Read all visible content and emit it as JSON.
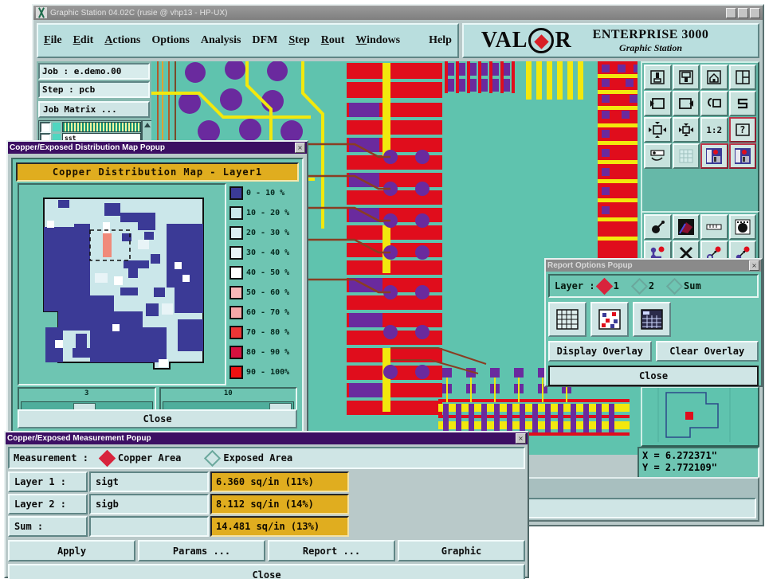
{
  "window": {
    "title": "Graphic Station 04.02C (rusie @ vhp13 - HP-UX)"
  },
  "menubar": {
    "items": [
      {
        "label": "File",
        "accel": "F"
      },
      {
        "label": "Edit",
        "accel": "E"
      },
      {
        "label": "Actions",
        "accel": "A"
      },
      {
        "label": "Options",
        "accel": "O"
      },
      {
        "label": "Analysis",
        "accel": ""
      },
      {
        "label": "DFM",
        "accel": ""
      },
      {
        "label": "Step",
        "accel": "S"
      },
      {
        "label": "Rout",
        "accel": "R"
      },
      {
        "label": "Windows",
        "accel": "W"
      },
      {
        "label": "Help",
        "accel": ""
      }
    ]
  },
  "branding": {
    "logo": "VALOR",
    "product": "ENTERPRISE 3000",
    "subtitle": "Graphic Station"
  },
  "job_panel": {
    "job_label": "Job   :  e.demo.00",
    "step_label": "Step :  pcb",
    "matrix_button": "Job Matrix ...",
    "layers": [
      {
        "name": "",
        "pattern": "dashed"
      },
      {
        "name": "sst",
        "pattern": "solid"
      }
    ]
  },
  "coords": {
    "x": "X = 6.272371\"",
    "y": "Y = 2.772109\""
  },
  "distribution_map": {
    "title": "Copper/Exposed Distribution Map Popup",
    "header": "Copper Distribution Map - Layer1",
    "close_label": "Close",
    "scale_left": "3",
    "scale_right": "10",
    "legend": [
      {
        "label": "0  - 10 %",
        "color": "#3b3a96"
      },
      {
        "label": "10 - 20 %",
        "color": "#cbe7ea"
      },
      {
        "label": "20 - 30 %",
        "color": "#dceff2"
      },
      {
        "label": "30 - 40 %",
        "color": "#e8f4f7"
      },
      {
        "label": "40 - 50 %",
        "color": "#ffffff"
      },
      {
        "label": "50 - 60 %",
        "color": "#f7b8b8"
      },
      {
        "label": "60 - 70 %",
        "color": "#f6a7a7"
      },
      {
        "label": "70 - 80 %",
        "color": "#ec3636"
      },
      {
        "label": "80 - 90 %",
        "color": "#d6123f"
      },
      {
        "label": "90 - 100%",
        "color": "#ef1111"
      }
    ]
  },
  "report_options": {
    "title": "Report Options Popup",
    "layer_label": "Layer :",
    "options": [
      {
        "label": "1",
        "selected": true
      },
      {
        "label": "2",
        "selected": false
      },
      {
        "label": "Sum",
        "selected": false
      }
    ],
    "display_overlay": "Display Overlay",
    "clear_overlay": "Clear Overlay",
    "close_label": "Close",
    "icons": [
      "grid-icon",
      "scatter-icon",
      "matrix-icon"
    ]
  },
  "measurement": {
    "title": "Copper/Exposed Measurement Popup",
    "measurement_label": "Measurement  :",
    "modes": [
      {
        "label": "Copper Area",
        "selected": true
      },
      {
        "label": "Exposed Area",
        "selected": false
      }
    ],
    "rows": [
      {
        "label": "Layer 1 :",
        "name": "sigt",
        "value": "6.360 sq/in (11%)"
      },
      {
        "label": "Layer 2 :",
        "name": "sigb",
        "value": "8.112 sq/in (14%)"
      },
      {
        "label": "Sum     :",
        "name": "",
        "value": "14.481 sq/in (13%)"
      }
    ],
    "buttons": [
      "Apply",
      "Params ...",
      "Report ...",
      "Graphic"
    ],
    "close_label": "Close"
  },
  "toolbox": {
    "row1": [
      "extract-up-icon",
      "insert-down-icon",
      "home-icon",
      "window-split-icon"
    ],
    "row2": [
      "pan-left-icon",
      "pan-right-icon",
      "rotate-icon",
      "s-shape-icon"
    ],
    "row3": [
      "zoom-fit-icon",
      "zoom-region-icon",
      "scale-1-2-icon",
      "help-query-icon"
    ],
    "row4": [
      "measure-icon",
      "grid-toggle-icon",
      "layer-compare-icon",
      "layer-compare-alt-icon"
    ],
    "row5": [
      "point-pick-icon",
      "polygon-icon",
      "ruler-icon",
      "pad-icon"
    ],
    "row6": [
      "net-icon",
      "delete-x-icon",
      "move-point-icon",
      "copy-point-icon"
    ],
    "scale_label": "1:2",
    "query_label": "?"
  },
  "colors": {
    "pcb_background": "#5fc3ae",
    "copper_red": "#e00d1c",
    "pad_purple": "#6a2a9e",
    "trace_yellow": "#f2e80d",
    "title_purple": "#3c0f63",
    "gold": "#e0ad1f"
  }
}
